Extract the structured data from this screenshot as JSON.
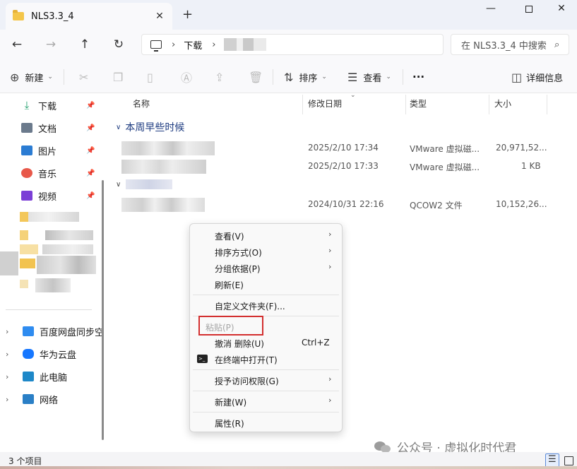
{
  "window": {
    "tab_title": "NLS3.3_4",
    "new_tab": "+",
    "close_tab": "✕",
    "minimize": "—",
    "close": "✕"
  },
  "address": {
    "crumb": "下载",
    "search_placeholder": "在 NLS3.3_4 中搜索"
  },
  "toolbar": {
    "new_label": "新建",
    "sort_label": "排序",
    "view_label": "查看",
    "more": "···",
    "details_label": "详细信息"
  },
  "sidebar": {
    "pinned": [
      {
        "label": "下载",
        "icon": "download-icon",
        "color": "#1e9e6a"
      },
      {
        "label": "文档",
        "icon": "document-icon",
        "color": "#5f6d7e"
      },
      {
        "label": "图片",
        "icon": "picture-icon",
        "color": "#2b7cd3"
      },
      {
        "label": "音乐",
        "icon": "music-icon",
        "color": "#e8584a"
      },
      {
        "label": "视频",
        "icon": "video-icon",
        "color": "#7b3fd6"
      }
    ],
    "locations": [
      {
        "label": "百度网盘同步空",
        "icon": "baidu-netdisk-icon",
        "color": "#2f8cf0"
      },
      {
        "label": "华为云盘",
        "icon": "cloud-icon",
        "color": "#1677ff"
      },
      {
        "label": "此电脑",
        "icon": "computer-icon",
        "color": "#1e88c8"
      },
      {
        "label": "网络",
        "icon": "network-icon",
        "color": "#2a7fc6"
      }
    ]
  },
  "columns": {
    "name": "名称",
    "modified": "修改日期",
    "type": "类型",
    "size": "大小"
  },
  "group": {
    "label": "本周早些时候"
  },
  "files": [
    {
      "modified": "2025/2/10 17:34",
      "type": "VMware 虚拟磁...",
      "size": "20,971,52..."
    },
    {
      "modified": "2025/2/10 17:33",
      "type": "VMware 虚拟磁...",
      "size": "1 KB"
    },
    {
      "modified": "2024/10/31 22:16",
      "type": "QCOW2 文件",
      "size": "10,152,26..."
    }
  ],
  "context_menu": {
    "view": "查看(V)",
    "sort": "排序方式(O)",
    "group": "分组依据(P)",
    "refresh": "刷新(E)",
    "customize": "自定义文件夹(F)...",
    "paste": "粘贴(P)",
    "undo": "撤消 删除(U)",
    "undo_key": "Ctrl+Z",
    "terminal": "在终端中打开(T)",
    "grant": "授予访问权限(G)",
    "new": "新建(W)",
    "properties": "属性(R)"
  },
  "status": {
    "count": "3 个项目"
  },
  "watermark": "公众号 · 虚拟化时代君"
}
